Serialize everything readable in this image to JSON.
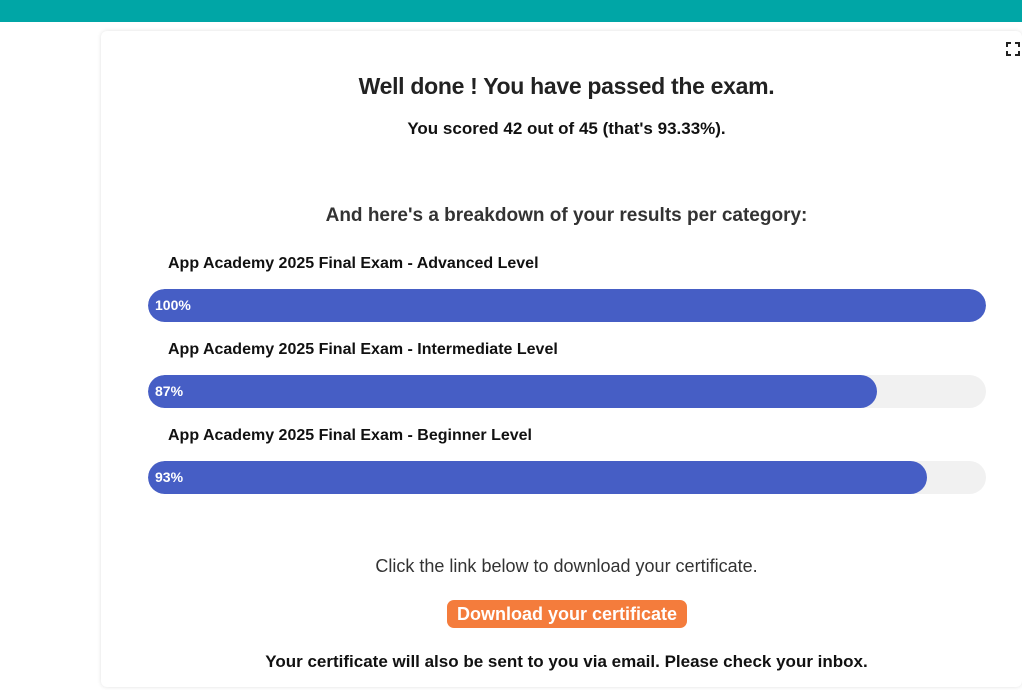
{
  "colors": {
    "header_bar": "#00a6a6",
    "progress_fill": "#465ec5",
    "progress_track": "#f1f1f1",
    "button_bg": "#f47c3c"
  },
  "header": {
    "fullscreen_icon": "fullscreen-icon"
  },
  "result": {
    "title": "Well done ! You have passed the exam.",
    "score_text": "You scored 42 out of 45 (that's 93.33%)."
  },
  "breakdown": {
    "heading": "And here's a breakdown of your results per category:",
    "categories": [
      {
        "label": "App Academy 2025 Final Exam - Advanced Level",
        "percent_text": "100%",
        "percent": 100
      },
      {
        "label": "App Academy 2025 Final Exam - Intermediate Level",
        "percent_text": "87%",
        "percent": 87
      },
      {
        "label": "App Academy 2025 Final Exam - Beginner Level",
        "percent_text": "93%",
        "percent": 93
      }
    ]
  },
  "certificate": {
    "hint": "Click the link below to download your certificate.",
    "button_label": "Download your certificate",
    "email_note": "Your certificate will also be sent to you via email. Please check your inbox."
  }
}
